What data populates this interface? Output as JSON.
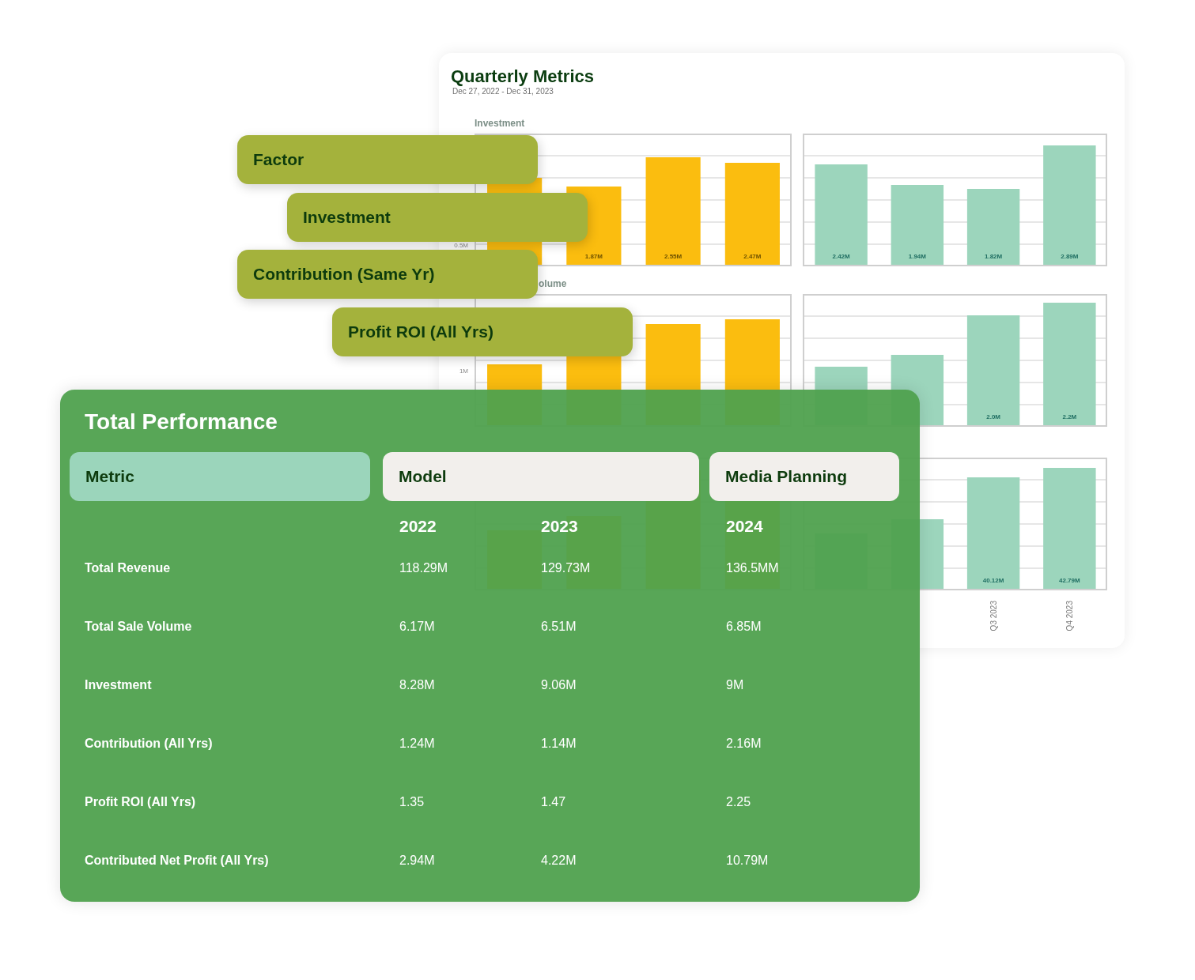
{
  "metrics_card": {
    "title": "Quarterly Metrics",
    "date_range": "Dec 27, 2022 - Dec 31, 2023",
    "charts": [
      {
        "kind": "drawing",
        "title": "Investment",
        "axis_label": "0.5M",
        "bar_labels": [
          "1.87M",
          "2.55M",
          "2.47M"
        ]
      },
      {
        "kind": "drawing",
        "bar_labels": [
          "2.42M",
          "1.94M",
          "1.82M",
          "2.89M"
        ]
      },
      {
        "kind": "drawing",
        "title": "olume",
        "axis_label": "1M"
      },
      {
        "kind": "drawing",
        "bar_labels": [
          "2.0M",
          "2.2M"
        ]
      },
      {
        "kind": "drawing"
      },
      {
        "kind": "drawing",
        "bar_labels": [
          "40.12M",
          "42.79M"
        ],
        "categories": [
          "Q3 2023",
          "Q4 2023"
        ]
      }
    ]
  },
  "factors": [
    {
      "label": "Factor"
    },
    {
      "label": "Investment"
    },
    {
      "label": "Contribution (Same Yr)"
    },
    {
      "label": "Profit ROI (All Yrs)"
    }
  ],
  "performance": {
    "title": "Total Performance",
    "headers": [
      {
        "label": "Metric",
        "kind": "metric"
      },
      {
        "label": "Model",
        "kind": "group"
      },
      {
        "label": "Media Planning",
        "kind": "group"
      }
    ],
    "years": [
      "2022",
      "2023",
      "2024"
    ],
    "rows": [
      {
        "metric": "Total Revenue",
        "values": [
          "118.29M",
          "129.73M",
          "136.5MM"
        ]
      },
      {
        "metric": "Total Sale Volume",
        "values": [
          "6.17M",
          "6.51M",
          "6.85M"
        ]
      },
      {
        "metric": "Investment",
        "values": [
          "8.28M",
          "9.06M",
          "9M"
        ]
      },
      {
        "metric": "Contribution (All Yrs)",
        "values": [
          "1.24M",
          "1.14M",
          "2.16M"
        ]
      },
      {
        "metric": "Profit ROI (All Yrs)",
        "values": [
          "1.35",
          "1.47",
          "2.25"
        ]
      },
      {
        "metric": "Contributed Net Profit (All Yrs)",
        "values": [
          "2.94M",
          "4.22M",
          "10.79M"
        ]
      }
    ]
  }
}
